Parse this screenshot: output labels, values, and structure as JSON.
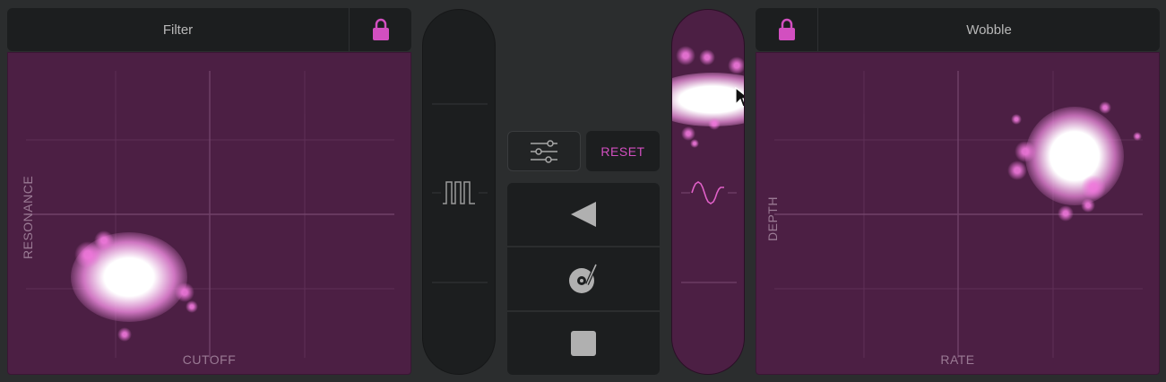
{
  "left_panel": {
    "title": "Filter",
    "lock_icon": "lock-icon",
    "x_axis": "CUTOFF",
    "y_axis": "RESONANCE",
    "touch_position": {
      "x": 0.32,
      "y": 0.7
    }
  },
  "right_panel": {
    "title": "Wobble",
    "lock_icon": "lock-icon",
    "x_axis": "RATE",
    "y_axis": "DEPTH",
    "touch_position": {
      "x": 0.8,
      "y": 0.32
    }
  },
  "left_slider": {
    "icon": "square-wave-icon"
  },
  "right_slider": {
    "icon": "sine-wave-icon",
    "level": 0.78
  },
  "controls": {
    "settings_icon": "sliders-icon",
    "reset_label": "RESET",
    "reverse_icon": "reverse-play-icon",
    "scratch_icon": "turntable-icon",
    "stop_icon": "stop-icon"
  },
  "colors": {
    "accent": "#d24fc0",
    "pad_bg": "#4c1f44",
    "button_bg": "#1c1e1f"
  }
}
